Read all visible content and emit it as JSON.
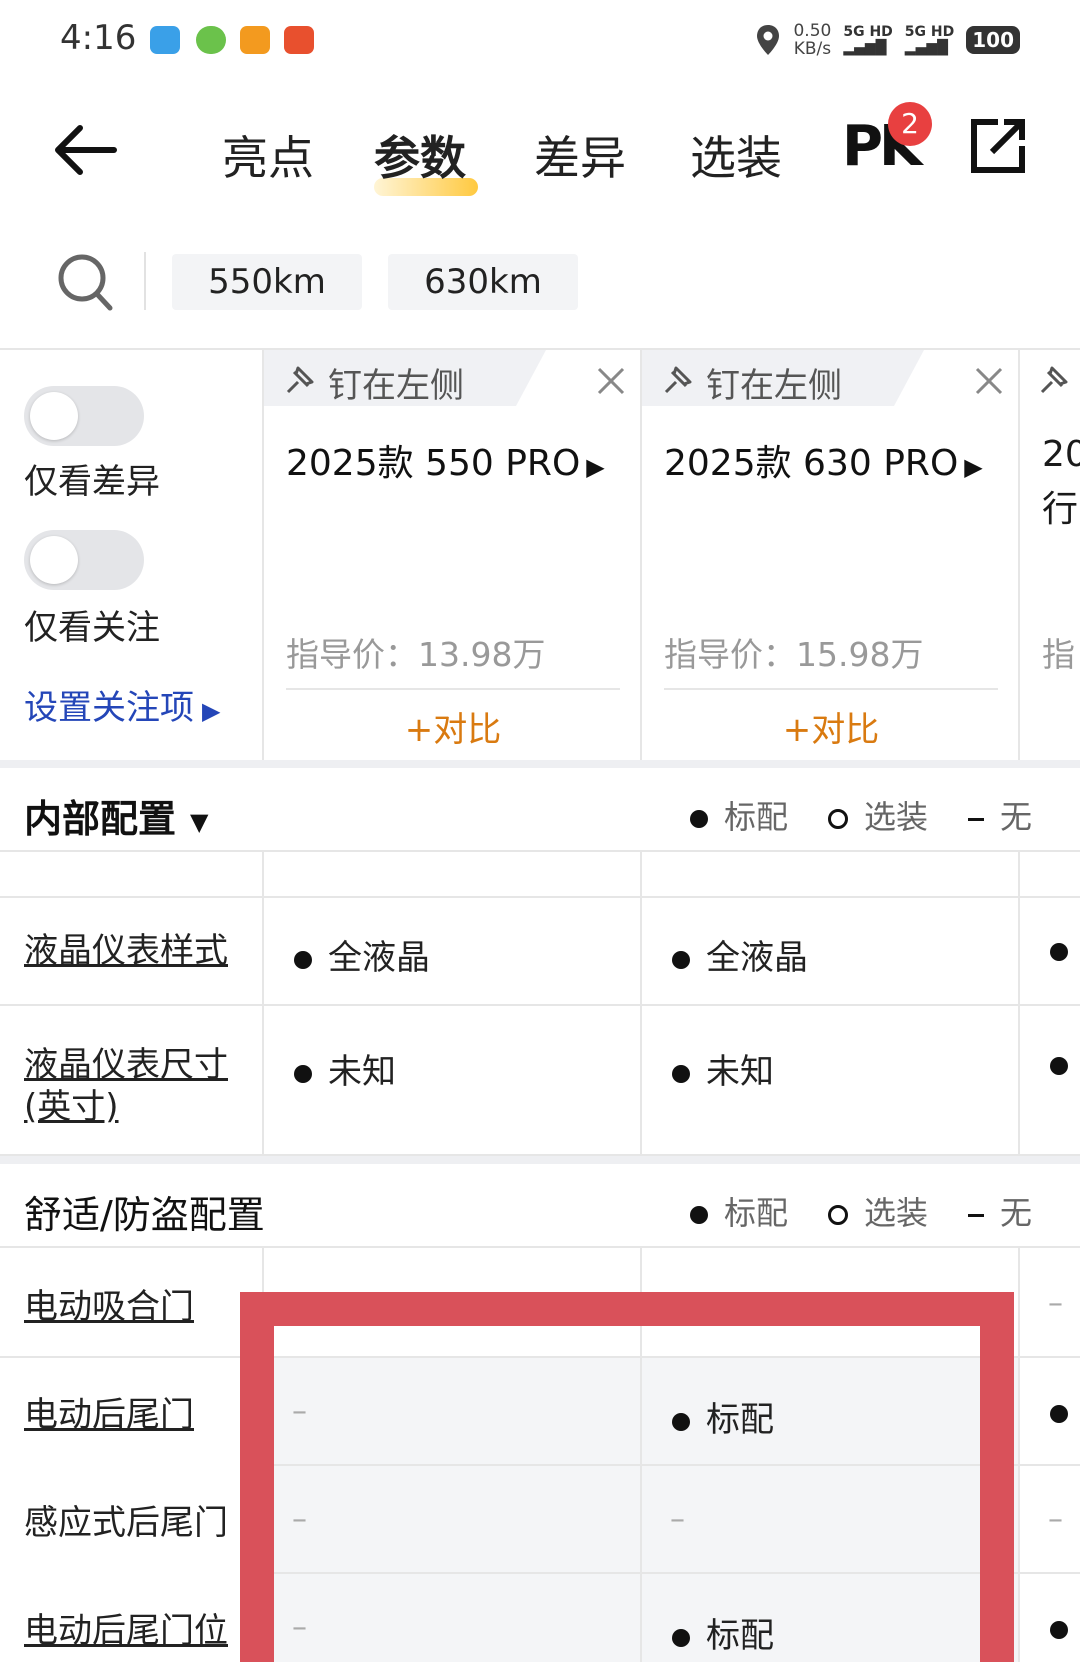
{
  "status_bar": {
    "time": "4:16",
    "speed_value": "0.50",
    "speed_unit": "KB/s",
    "sim1": "5G HD",
    "sim2": "5G HD",
    "battery": "100"
  },
  "nav": {
    "tabs": [
      "亮点",
      "参数",
      "差异",
      "选装"
    ],
    "active_tab": "参数",
    "pk_label": "PK",
    "pk_badge": "2"
  },
  "search": {
    "chips": [
      "550km",
      "630km"
    ]
  },
  "filters": {
    "only_diff_label": "仅看差异",
    "only_focus_label": "仅看关注",
    "set_focus_link": "设置关注项",
    "only_diff_on": false,
    "only_focus_on": false
  },
  "cars": [
    {
      "pin_label": "钉在左侧",
      "name": "2025款 550 PRO",
      "price": "指导价：13.98万",
      "compare": "+对比"
    },
    {
      "pin_label": "钉在左侧",
      "name": "2025款 630 PRO",
      "price": "指导价：15.98万",
      "compare": "+对比"
    },
    {
      "name_partial": "20",
      "name_partial2": "行",
      "price_partial": "指"
    }
  ],
  "legend": {
    "standard": "标配",
    "optional": "选装",
    "none": "无"
  },
  "sections": [
    {
      "title": "内部配置",
      "rows": [
        {
          "label": "液晶仪表样式",
          "values": [
            "全液晶",
            "全液晶"
          ]
        },
        {
          "label": "液晶仪表尺寸(英寸)",
          "values": [
            "未知",
            "未知"
          ]
        }
      ]
    },
    {
      "title": "舒适/防盗配置",
      "rows": [
        {
          "label": "电动吸合门",
          "values": [
            "",
            ""
          ],
          "third": "–"
        },
        {
          "label": "电动后尾门",
          "values": [
            "–",
            "标配"
          ]
        },
        {
          "label": "感应式后尾门",
          "values": [
            "–",
            "–"
          ],
          "third": "–"
        },
        {
          "label": "电动后尾门位",
          "values": [
            "–",
            "标配"
          ]
        }
      ]
    }
  ],
  "colors": {
    "accent_orange": "#d97a10",
    "link_blue": "#2446b8",
    "highlight_red": "#d9515a",
    "badge_red": "#e84040"
  }
}
